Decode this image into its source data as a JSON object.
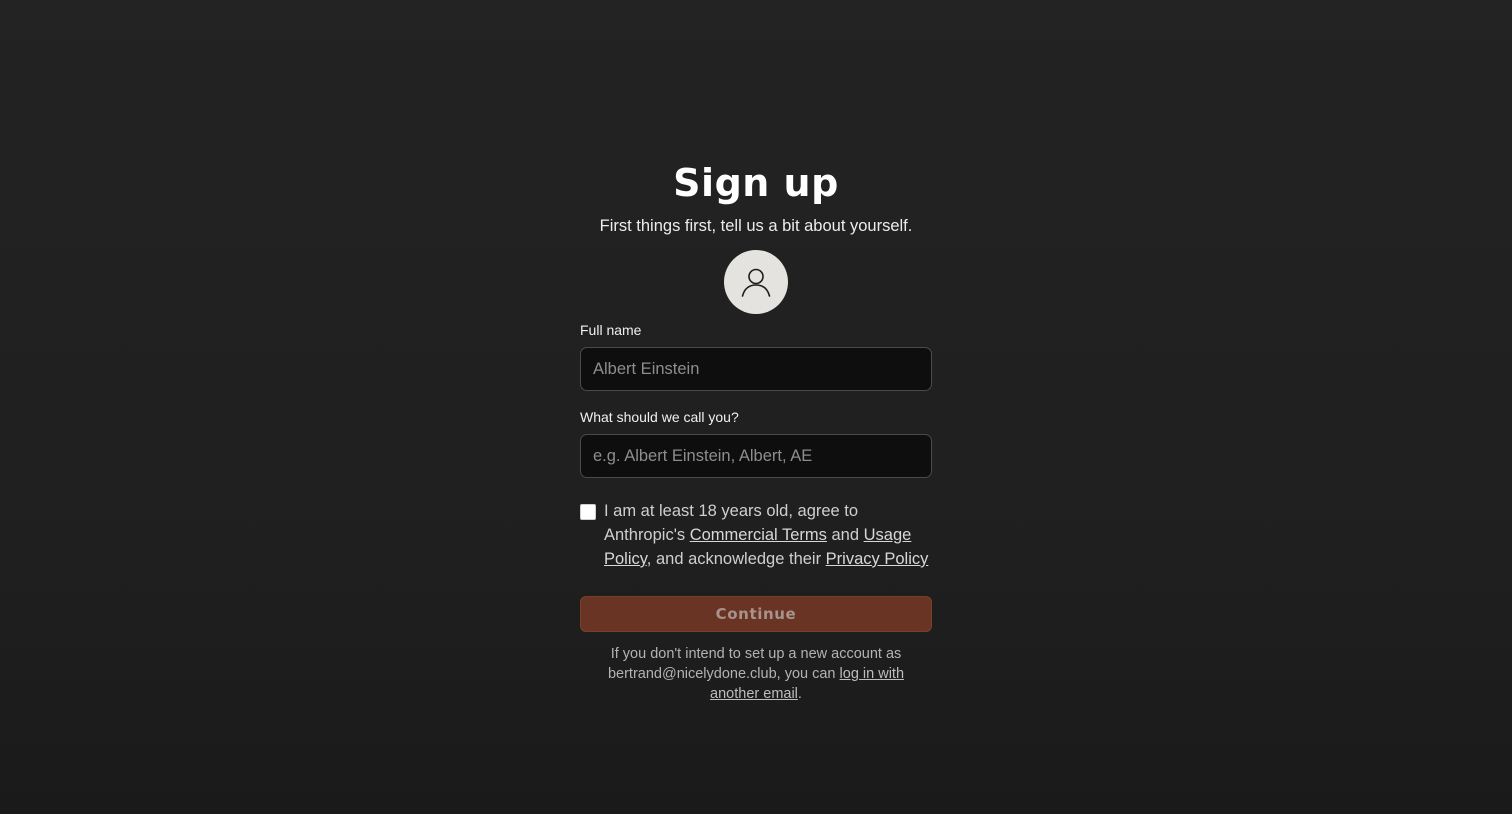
{
  "page": {
    "title": "Sign up",
    "subtitle": "First things first, tell us a bit about yourself."
  },
  "avatar": {
    "icon": "user-icon"
  },
  "form": {
    "full_name": {
      "label": "Full name",
      "value": "",
      "placeholder": "Albert Einstein"
    },
    "nickname": {
      "label": "What should we call you?",
      "value": "",
      "placeholder": "e.g. Albert Einstein, Albert, AE"
    },
    "terms": {
      "checked": false,
      "text_prefix": "I am at least 18 years old, agree to Anthropic's ",
      "commercial_terms_link": "Commercial Terms",
      "text_and": " and ",
      "usage_policy_link": "Usage Policy",
      "text_mid": ", and acknowledge their ",
      "privacy_policy_link": "Privacy Policy"
    },
    "continue_label": "Continue"
  },
  "footer": {
    "text_prefix": "If you don't intend to set up a new account as bertrand@nicelydone.club, you can ",
    "link_text": "log in with another email",
    "text_suffix": "."
  },
  "colors": {
    "background": "#212121",
    "input_background": "#0e0e0e",
    "button_background": "#6a3424",
    "avatar_background": "#e4e3df"
  }
}
